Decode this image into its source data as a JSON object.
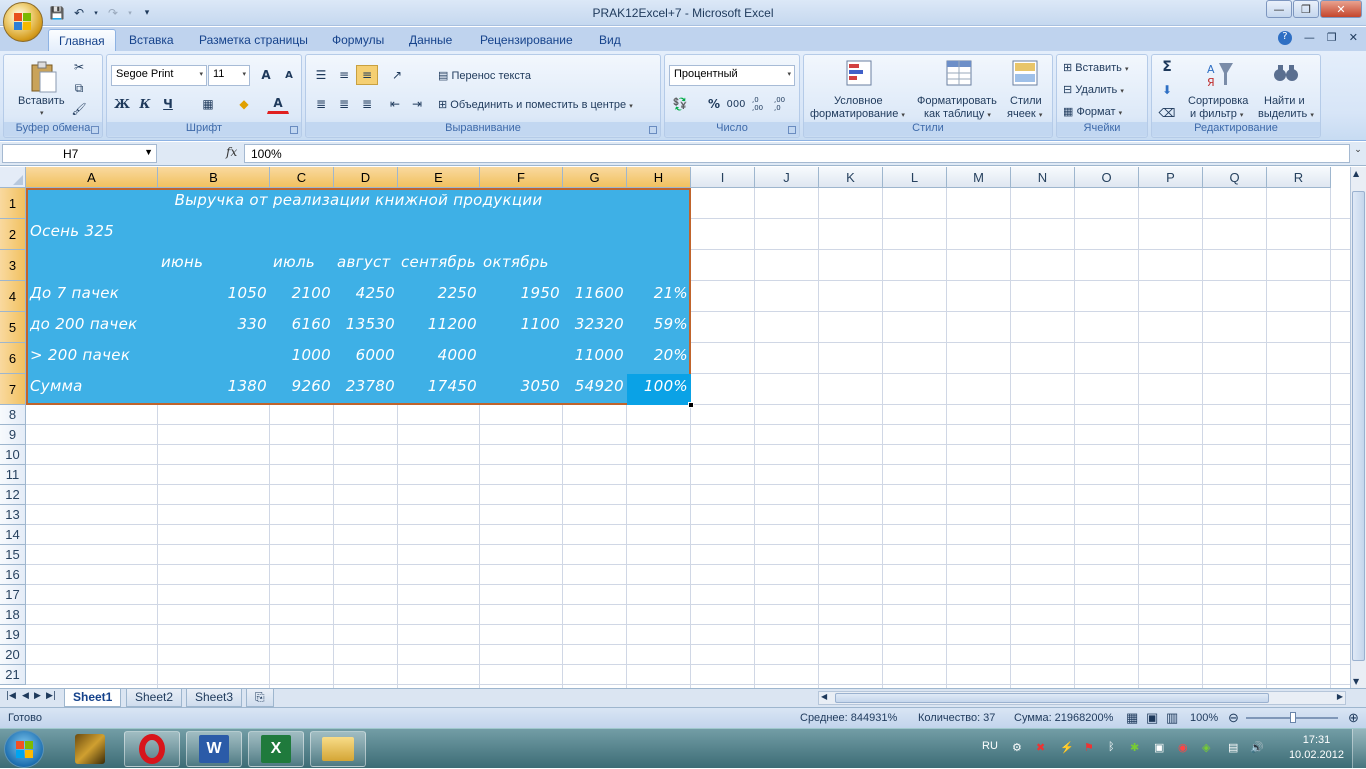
{
  "window": {
    "title": "PRAK12Excel+7  -  Microsoft Excel",
    "minimize": "—",
    "restore": "❐",
    "close": "✕"
  },
  "tabs": [
    "Главная",
    "Вставка",
    "Разметка страницы",
    "Формулы",
    "Данные",
    "Рецензирование",
    "Вид"
  ],
  "ribbon": {
    "clipboard": {
      "label": "Буфер обмена",
      "paste": "Вставить"
    },
    "font": {
      "label": "Шрифт",
      "name": "Segoe Print",
      "size": "11",
      "bold": "Ж",
      "italic": "К",
      "underline": "Ч",
      "grow": "A",
      "shrink": "A",
      "font_color": "A"
    },
    "alignment": {
      "label": "Выравнивание",
      "wrap": "Перенос текста",
      "merge": "Объединить и поместить в центре"
    },
    "number": {
      "label": "Число",
      "format": "Процентный",
      "percent": "%",
      "thousands": "000",
      "inc_dec": ",0 ,00",
      "dec_dec": ",00 ,0"
    },
    "styles": {
      "label": "Стили",
      "conditional": "Условное\nформатирование",
      "conditional_l1": "Условное",
      "conditional_l2": "форматирование",
      "as_table_l1": "Форматировать",
      "as_table_l2": "как таблицу",
      "cell_styles_l1": "Стили",
      "cell_styles_l2": "ячеек"
    },
    "cells": {
      "label": "Ячейки",
      "insert": "Вставить",
      "delete": "Удалить",
      "format": "Формат"
    },
    "editing": {
      "label": "Редактирование",
      "sum": "Σ",
      "sort_l1": "Сортировка",
      "sort_l2": "и фильтр",
      "find_l1": "Найти и",
      "find_l2": "выделить"
    }
  },
  "formula_bar": {
    "name_box": "H7",
    "fx": "fx",
    "value": "100%"
  },
  "columns": [
    "A",
    "B",
    "C",
    "D",
    "E",
    "F",
    "G",
    "H",
    "I",
    "J",
    "K",
    "L",
    "M",
    "N",
    "O",
    "P",
    "Q",
    "R"
  ],
  "rows": [
    "1",
    "2",
    "3",
    "4",
    "5",
    "6",
    "7",
    "8",
    "9",
    "10",
    "11",
    "12",
    "13",
    "14",
    "15",
    "16",
    "17",
    "18",
    "19",
    "20",
    "21"
  ],
  "sheet": {
    "title": "Выручка от реализации книжной продукции",
    "subtitle": "Осень 325",
    "months": [
      "июнь",
      "июль",
      "август",
      "сентябрь",
      "октябрь"
    ],
    "rows": [
      {
        "label": "До 7 пачек",
        "B": "1050",
        "C": "2100",
        "D": "4250",
        "E": "2250",
        "F": "1950",
        "G": "11600",
        "H": "21%"
      },
      {
        "label": "до 200 пачек",
        "B": "330",
        "C": "6160",
        "D": "13530",
        "E": "11200",
        "F": "1100",
        "G": "32320",
        "H": "59%"
      },
      {
        "label": "> 200 пачек",
        "B": "",
        "C": "1000",
        "D": "6000",
        "E": "4000",
        "F": "",
        "G": "11000",
        "H": "20%"
      },
      {
        "label": "Сумма",
        "B": "1380",
        "C": "9260",
        "D": "23780",
        "E": "17450",
        "F": "3050",
        "G": "54920",
        "H": "100%"
      }
    ]
  },
  "sheet_tabs": [
    "Sheet1",
    "Sheet2",
    "Sheet3"
  ],
  "status": {
    "ready": "Готово",
    "average": "Среднее: 844931%",
    "count": "Количество: 37",
    "sum": "Сумма: 21968200%",
    "zoom": "100%"
  },
  "taskbar": {
    "lang": "RU",
    "time": "17:31",
    "date": "10.02.2012"
  },
  "colors": {
    "range_fill": "#3eb0e6",
    "active_cell": "#0aa2e6",
    "range_border": "#c0642c"
  }
}
